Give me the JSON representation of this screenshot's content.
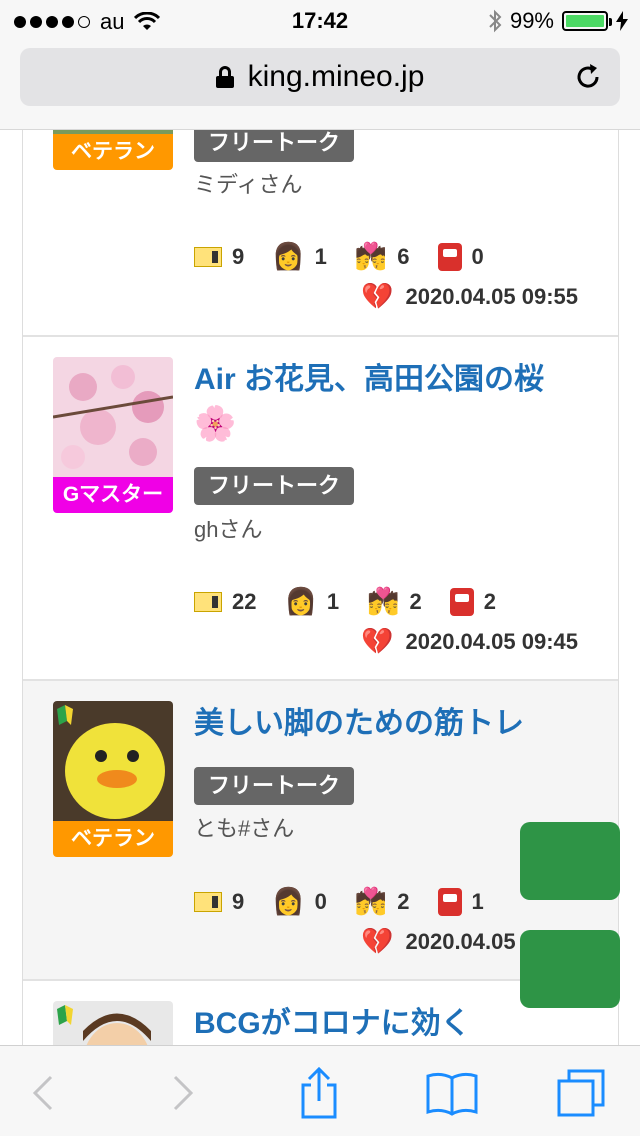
{
  "status": {
    "carrier": "au",
    "time": "17:42",
    "battery": "99%",
    "signal_dots_filled": 4,
    "battery_fill_fraction": 0.99
  },
  "browser": {
    "url": "king.mineo.jp",
    "icons": [
      "lock-icon",
      "reload-icon",
      "back-icon",
      "forward-icon",
      "share-icon",
      "bookmarks-icon",
      "tabs-icon"
    ],
    "accent_color": "#1a8cff"
  },
  "posts": [
    {
      "rank": "ベテラン",
      "rank_color": "#ff9800",
      "category": "フリートーク",
      "author": "ミディさん",
      "stats": {
        "tickets": "9",
        "person": "1",
        "kiss": "6",
        "postbox": "0"
      },
      "date": "2020.04.05 09:55"
    },
    {
      "title": "Air お花見、高田公園の桜",
      "title_emoji": "🌸",
      "rank": "Gマスター",
      "rank_color": "#f000e6",
      "category": "フリートーク",
      "author": "ghさん",
      "stats": {
        "tickets": "22",
        "person": "1",
        "kiss": "2",
        "postbox": "2"
      },
      "date": "2020.04.05 09:45"
    },
    {
      "title": "美しい脚のための筋トレ",
      "rank": "ベテラン",
      "rank_color": "#ff9800",
      "category": "フリートーク",
      "author": "とも#さん",
      "stats": {
        "tickets": "9",
        "person": "0",
        "kiss": "2",
        "postbox": "1"
      },
      "date": "2020.04.05 09:38"
    },
    {
      "title": "BCGがコロナに効く"
    }
  ],
  "emojis": {
    "person": "👩",
    "kiss": "💏",
    "broken_heart": "💔"
  },
  "colors": {
    "title": "#1e6fb7",
    "tag_bg": "#666666",
    "float_button": "#2e9446"
  }
}
